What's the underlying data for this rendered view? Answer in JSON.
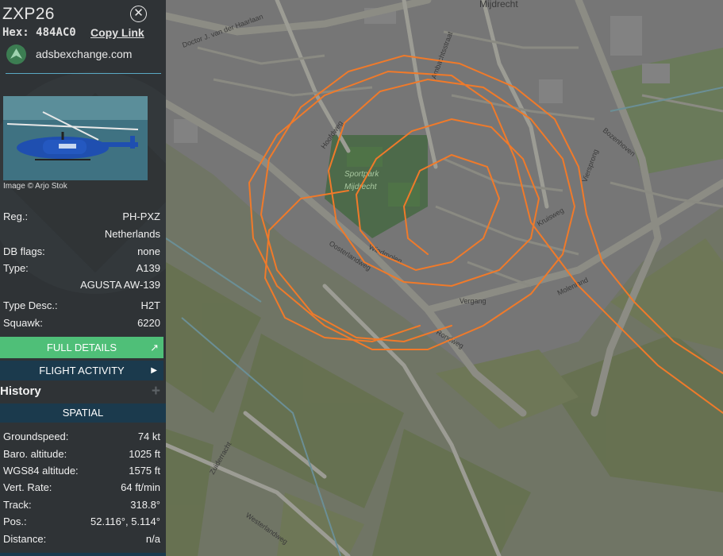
{
  "aircraft": {
    "callsign": "ZXP26",
    "hex_label": "Hex:",
    "hex": "484AC0",
    "copy_link": "Copy Link",
    "source_site": "adsbexchange.com",
    "photo_credit": "Image © Arjo Stok"
  },
  "details": [
    {
      "label": "Reg.:",
      "value": "PH-PXZ"
    },
    {
      "label": "",
      "value": "Netherlands"
    },
    {
      "label": "DB flags:",
      "value": "none"
    },
    {
      "label": "Type:",
      "value": "A139"
    },
    {
      "label": "",
      "value": "AGUSTA AW-139"
    },
    {
      "label": "Type Desc.:",
      "value": "H2T"
    },
    {
      "label": "Squawk:",
      "value": "6220"
    }
  ],
  "buttons": {
    "full_details": "FULL DETAILS",
    "flight_activity": "FLIGHT ACTIVITY",
    "history": "History",
    "spatial": "SPATIAL"
  },
  "spatial": [
    {
      "label": "Groundspeed:",
      "value": "74 kt"
    },
    {
      "label": "Baro. altitude:",
      "value": "1025 ft"
    },
    {
      "label": "WGS84 altitude:",
      "value": "1575 ft"
    },
    {
      "label": "Vert. Rate:",
      "value": "64 ft/min"
    },
    {
      "label": "Track:",
      "value": "318.8°"
    },
    {
      "label": "Pos.:",
      "value": "52.116°, 5.114°"
    },
    {
      "label": "Distance:",
      "value": "n/a"
    }
  ],
  "map_labels": {
    "town": "Mijdrecht",
    "park": "Sportpark",
    "park2": "Mijdrecht",
    "streets": [
      "Doctor J. van der Haarlaan",
      "Oosterlandweg",
      "Hoofdweg",
      "Vergang",
      "Molenland",
      "Zuiderracht",
      "Westerlandweg",
      "Bozenhoven",
      "Kruisweg",
      "Windmolen",
      "Ambachtsstraat",
      "Viersprong",
      "Rondweg"
    ]
  },
  "colors": {
    "sidebar_bg": "#2f3336",
    "accent_green": "#4fbf78",
    "nav_blue": "#1b3a4d",
    "track_orange": "#f07a2a"
  },
  "icons": {
    "close": "close-icon",
    "logo": "adsbexchange-logo-icon",
    "external": "external-link-icon",
    "arrow": "caret-right-icon",
    "plus": "plus-icon"
  }
}
